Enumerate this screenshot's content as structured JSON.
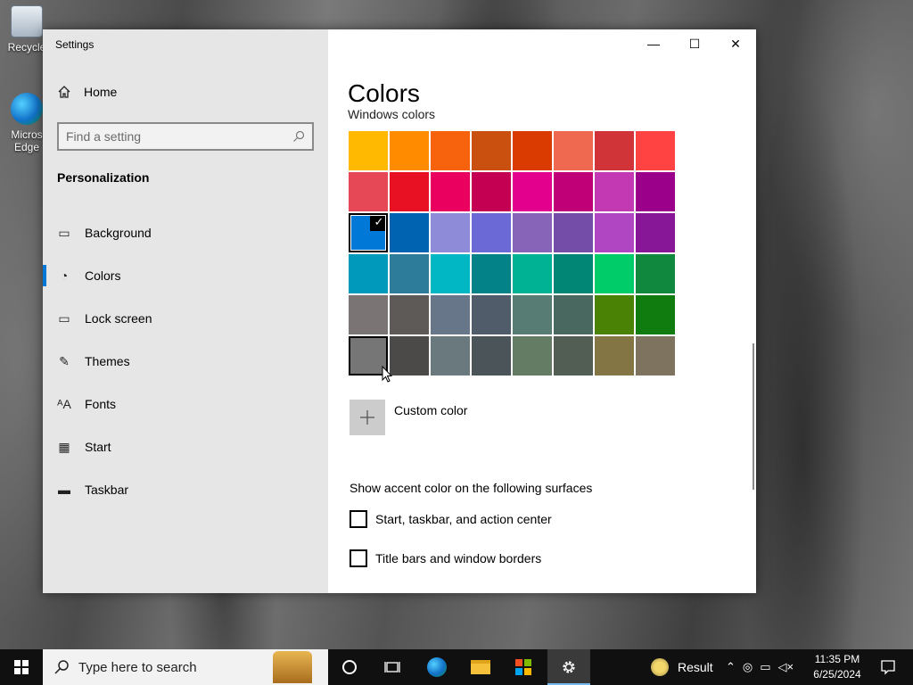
{
  "desktop": {
    "icons": [
      {
        "label": "Recycle",
        "icon": "recycle-bin-icon"
      },
      {
        "label": "Micros Edge",
        "icon": "edge-icon"
      }
    ]
  },
  "window": {
    "title": "Settings",
    "controls": {
      "minimize": "—",
      "maximize": "☐",
      "close": "✕"
    }
  },
  "sidebar": {
    "home_label": "Home",
    "search_placeholder": "Find a setting",
    "section": "Personalization",
    "items": [
      {
        "label": "Background",
        "icon": "picture-icon",
        "glyph": "▭",
        "active": false
      },
      {
        "label": "Colors",
        "icon": "palette-icon",
        "glyph": "◔",
        "active": true
      },
      {
        "label": "Lock screen",
        "icon": "lock-screen-icon",
        "glyph": "▭",
        "active": false
      },
      {
        "label": "Themes",
        "icon": "themes-icon",
        "glyph": "✎",
        "active": false
      },
      {
        "label": "Fonts",
        "icon": "fonts-icon",
        "glyph": "ᴬA",
        "active": false
      },
      {
        "label": "Start",
        "icon": "start-icon",
        "glyph": "▦",
        "active": false
      },
      {
        "label": "Taskbar",
        "icon": "taskbar-icon",
        "glyph": "▬",
        "active": false
      }
    ]
  },
  "content": {
    "title": "Colors",
    "windows_colors_label": "Windows colors",
    "swatches": [
      "#FFB900",
      "#FF8C00",
      "#F7630C",
      "#CA5010",
      "#DA3B01",
      "#EF6950",
      "#D13438",
      "#FF4343",
      "#E74856",
      "#E81123",
      "#EA005E",
      "#C30052",
      "#E3008C",
      "#BF0077",
      "#C239B3",
      "#9A0089",
      "#0078D7",
      "#0063B1",
      "#8E8CD8",
      "#6B69D6",
      "#8764B8",
      "#744DA9",
      "#B146C2",
      "#881798",
      "#0099BC",
      "#2D7D9A",
      "#00B7C3",
      "#038387",
      "#00B294",
      "#018574",
      "#00CC6A",
      "#10893E",
      "#7A7574",
      "#5D5A58",
      "#68768A",
      "#515C6B",
      "#567C73",
      "#486860",
      "#498205",
      "#107C10",
      "#767676",
      "#4C4A48",
      "#69797E",
      "#4A5459",
      "#647C64",
      "#525E54",
      "#847545",
      "#7E735F"
    ],
    "selected_index": 16,
    "hovered_index": 40,
    "custom_color_label": "Custom color",
    "surfaces_heading": "Show accent color on the following surfaces",
    "checkboxes": [
      {
        "label": "Start, taskbar, and action center",
        "checked": false
      },
      {
        "label": "Title bars and window borders",
        "checked": false
      }
    ]
  },
  "taskbar": {
    "search_placeholder": "Type here to search",
    "weather_label": "Result",
    "time": "11:35 PM",
    "date": "6/25/2024",
    "accent": "#76B9ED"
  }
}
